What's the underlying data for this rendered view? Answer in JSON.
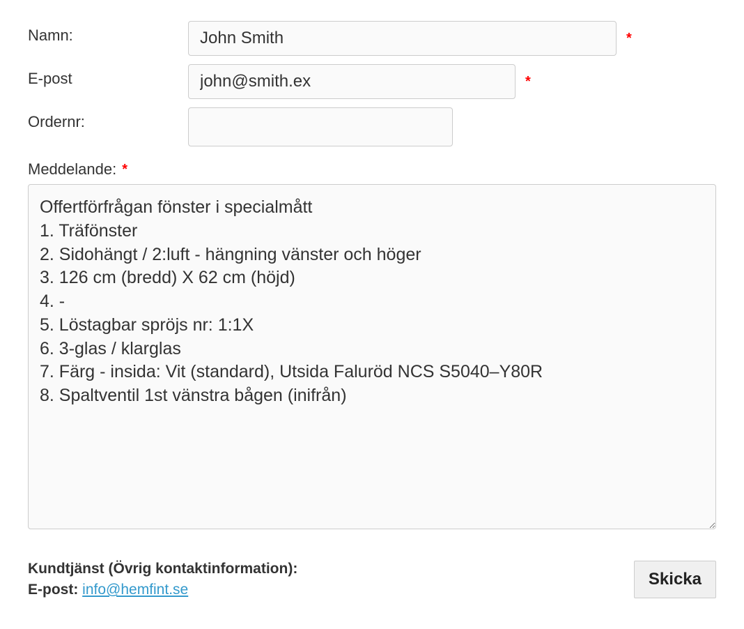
{
  "form": {
    "name": {
      "label": "Namn:",
      "value": "John Smith",
      "required": true
    },
    "email": {
      "label": "E-post",
      "value": "john@smith.ex",
      "required": true
    },
    "order": {
      "label": "Ordernr:",
      "value": "",
      "required": false
    },
    "message": {
      "label": "Meddelande:",
      "required": true,
      "value": "Offertförfrågan fönster i specialmått\n1. Träfönster\n2. Sidohängt / 2:luft - hängning vänster och höger\n3. 126 cm (bredd) X 62 cm (höjd)\n4. -\n5. Löstagbar spröjs nr: 1:1X\n6. 3-glas / klarglas\n7. Färg - insida: Vit (standard), Utsida Faluröd NCS S5040–Y80R\n8. Spaltventil 1st vänstra bågen (inifrån)"
    }
  },
  "contact": {
    "heading": "Kundtjänst (Övrig kontaktinformation):",
    "email_label": "E-post: ",
    "email_value": "info@hemfint.se"
  },
  "submit_label": "Skicka",
  "required_marker": "*"
}
